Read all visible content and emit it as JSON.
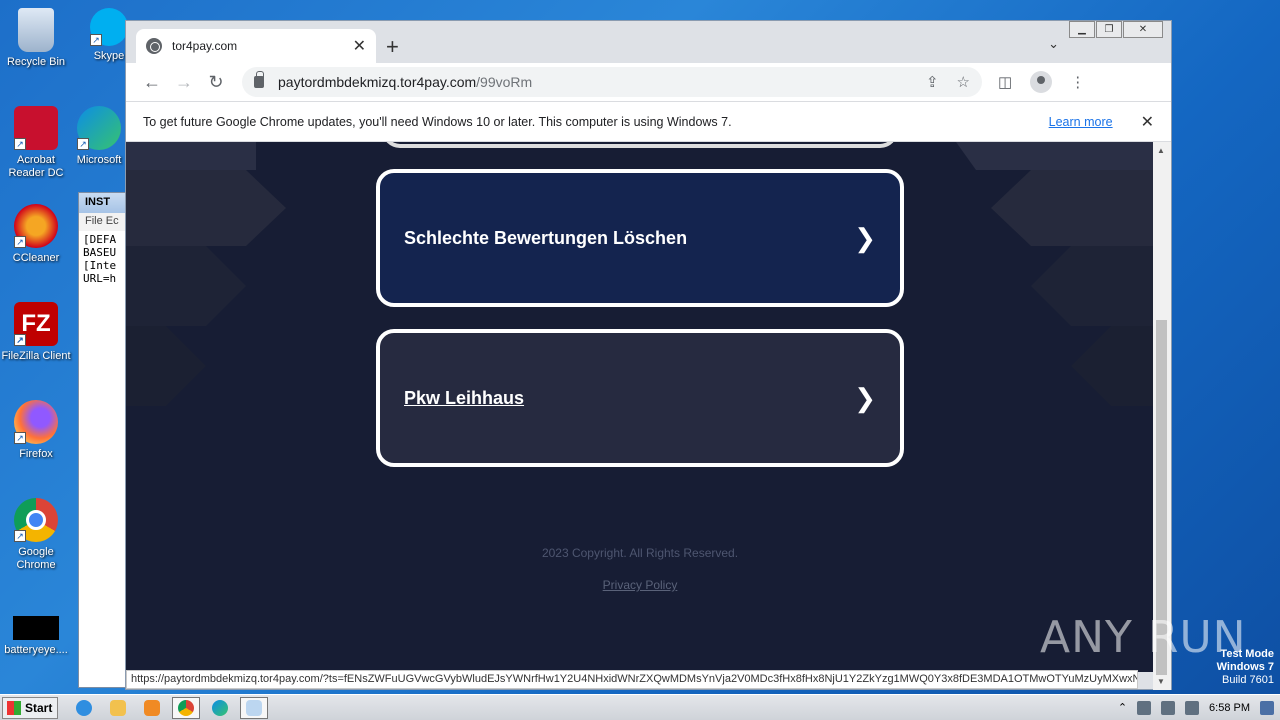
{
  "desktop": {
    "icons": [
      {
        "label": "Recycle Bin"
      },
      {
        "label": "Skype"
      },
      {
        "label": "Acrobat Reader DC"
      },
      {
        "label": "Microsoft"
      },
      {
        "label": "CCleaner"
      },
      {
        "label": "FileZilla Client"
      },
      {
        "label": "Firefox"
      },
      {
        "label": "Google Chrome"
      },
      {
        "label": "batteryeye...."
      }
    ]
  },
  "notepad": {
    "title": "INST",
    "menu": "File  Ec",
    "lines": [
      "[DEFA",
      "BASEU",
      "[Inte",
      "URL=h"
    ]
  },
  "browser": {
    "tab_title": "tor4pay.com",
    "new_tab": "+",
    "url_host": "paytordmbdekmizq.tor4pay.com",
    "url_path": "/99voRm",
    "infobar_text": "To get future Google Chrome updates, you'll need Windows 10 or later. This computer is using Windows 7.",
    "infobar_link": "Learn more",
    "status_url": "https://paytordmbdekmizq.tor4pay.com/?ts=fENsZWFuUGVwcGVybWludEJsYWNrfHw1Y2U4NHxidWNrZXQwMDMsYnVja2V0MDc3fHx8fHx8NjU1Y2ZkYzg1MWQ0Y3x8fDE3MDA1OTMwOTYuMzUyMXwxNjlmM2U..."
  },
  "page": {
    "cards": [
      {
        "label": "Schlechte Bewertungen Löschen"
      },
      {
        "label": "Pkw Leihhaus"
      }
    ],
    "copyright": "2023 Copyright. All Rights Reserved.",
    "privacy": "Privacy Policy"
  },
  "watermark": "ANY RUN",
  "testmode": {
    "line1": "Test Mode",
    "line2": "Windows 7",
    "line3": "Build 7601"
  },
  "taskbar": {
    "start": "Start",
    "time": "6:58 PM"
  },
  "colors": {
    "page_bg": "#171d34",
    "card1_bg": "#14244f",
    "card2_bg": "#262a40",
    "link_blue": "#1a73e8"
  }
}
